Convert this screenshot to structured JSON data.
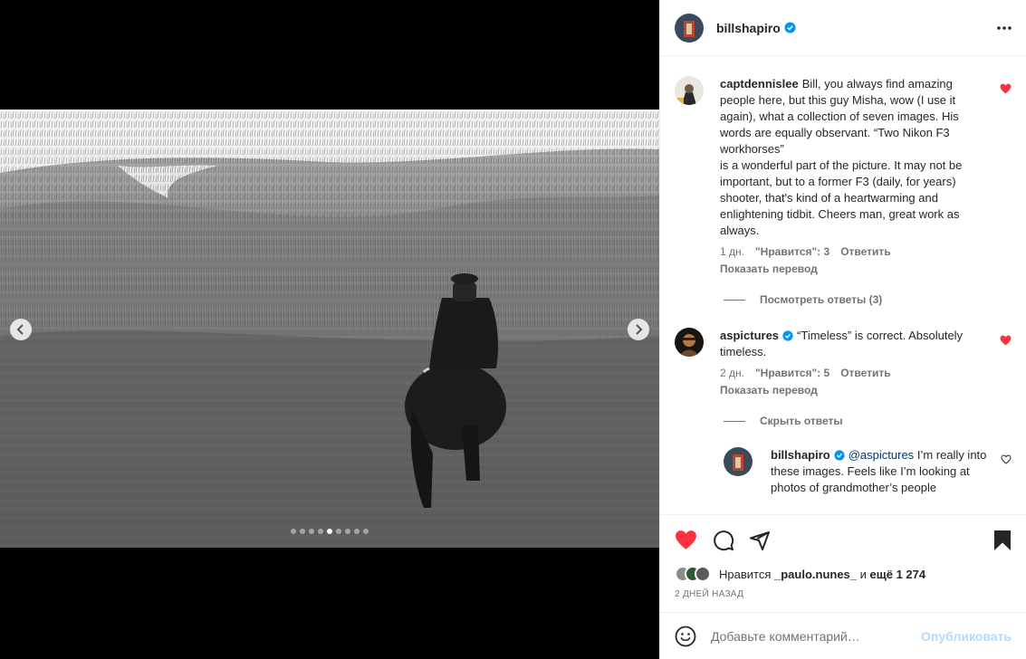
{
  "post": {
    "author": "billshapiro",
    "carousel": {
      "total": 9,
      "active_index": 4
    }
  },
  "comments": [
    {
      "user": "captdennislee",
      "text": "Bill, you always find amazing people here, but this guy Misha, wow (I use it again), what a collection of seven images. His words are equally observant. “Two Nikon F3 workhorses”",
      "text2": "is a wonderful part of the picture. It may not be important, but to a former F3 (daily, for years) shooter, that's kind of a heartwarming and enlightening tidbit. Cheers man, great work as always.",
      "time": "1 дн.",
      "likes": "\"Нравится\": 3",
      "reply": "Ответить",
      "translate": "Показать перевод",
      "replies_toggle": "Посмотреть ответы (3)",
      "liked": true
    },
    {
      "user": "aspictures",
      "verified": true,
      "text": "“Timeless” is correct. Absolutely timeless.",
      "time": "2 дн.",
      "likes": "\"Нравится\": 5",
      "reply": "Ответить",
      "translate": "Показать перевод",
      "replies_toggle": "Скрыть ответы",
      "liked": true
    },
    {
      "user": "billshapiro",
      "verified": true,
      "mention": "@aspictures",
      "text": "I’m really into these images. Feels like I’m looking at photos of grandmother’s people",
      "liked": false
    }
  ],
  "likes": {
    "prefix": "Нравится",
    "user": "_paulo.nunes_",
    "middle": "и",
    "others": "ещё 1 274"
  },
  "date": "2 ДНЕЙ НАЗАД",
  "add_comment": {
    "placeholder": "Добавьте комментарий…",
    "publish": "Опубликовать"
  },
  "colors": {
    "heart_red": "#ff3040",
    "verified_blue": "#0095f6",
    "publish_disabled": "#b3dbff"
  }
}
